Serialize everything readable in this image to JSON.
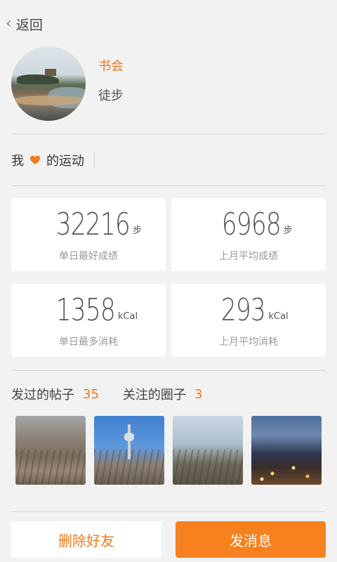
{
  "header": {
    "back_label": "返回"
  },
  "profile": {
    "name": "书会",
    "activity": "徒步"
  },
  "sport": {
    "prefix": "我",
    "suffix": "的运动"
  },
  "stats": [
    {
      "value": "32216",
      "unit": "步",
      "caption": "单日最好成绩"
    },
    {
      "value": "6968",
      "unit": "步",
      "caption": "上月平均成绩"
    },
    {
      "value": "1358",
      "unit": "kCal",
      "caption": "单日最多消耗"
    },
    {
      "value": "293",
      "unit": "kCal",
      "caption": "上月平均消耗"
    }
  ],
  "posts": {
    "label": "发过的帖子",
    "count": "35"
  },
  "circles": {
    "label": "关注的圈子",
    "count": "3"
  },
  "buttons": {
    "delete_friend": "删除好友",
    "send_message": "发消息"
  },
  "colors": {
    "accent": "#f07a1d",
    "background": "#f2f2f2",
    "card": "#ffffff"
  }
}
